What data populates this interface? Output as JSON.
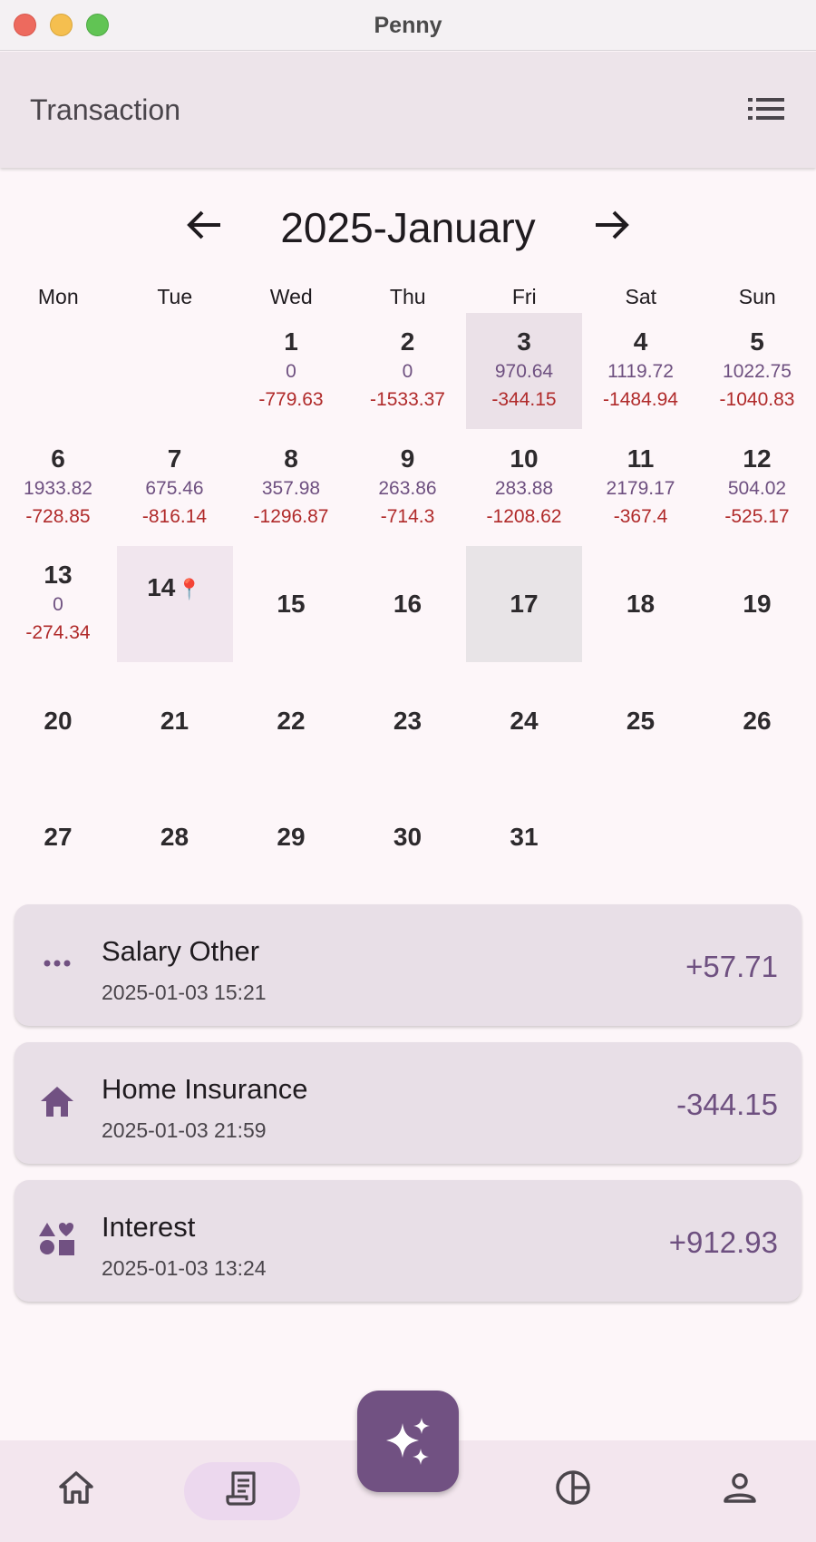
{
  "window": {
    "title": "Penny"
  },
  "appbar": {
    "title": "Transaction",
    "list_icon": "list-icon"
  },
  "calendar": {
    "month_label": "2025-January",
    "prev_icon": "arrow-left-icon",
    "next_icon": "arrow-right-icon",
    "weekdays": [
      "Mon",
      "Tue",
      "Wed",
      "Thu",
      "Fri",
      "Sat",
      "Sun"
    ],
    "days": [
      {
        "day": "1",
        "income": "0",
        "expense": "-779.63"
      },
      {
        "day": "2",
        "income": "0",
        "expense": "-1533.37"
      },
      {
        "day": "3",
        "income": "970.64",
        "expense": "-344.15"
      },
      {
        "day": "4",
        "income": "1119.72",
        "expense": "-1484.94"
      },
      {
        "day": "5",
        "income": "1022.75",
        "expense": "-1040.83"
      },
      {
        "day": "6",
        "income": "1933.82",
        "expense": "-728.85"
      },
      {
        "day": "7",
        "income": "675.46",
        "expense": "-816.14"
      },
      {
        "day": "8",
        "income": "357.98",
        "expense": "-1296.87"
      },
      {
        "day": "9",
        "income": "263.86",
        "expense": "-714.3"
      },
      {
        "day": "10",
        "income": "283.88",
        "expense": "-1208.62"
      },
      {
        "day": "11",
        "income": "2179.17",
        "expense": "-367.4"
      },
      {
        "day": "12",
        "income": "504.02",
        "expense": "-525.17"
      },
      {
        "day": "13",
        "income": "0",
        "expense": "-274.34"
      },
      {
        "day": "14"
      },
      {
        "day": "15"
      },
      {
        "day": "16"
      },
      {
        "day": "17"
      },
      {
        "day": "18"
      },
      {
        "day": "19"
      },
      {
        "day": "20"
      },
      {
        "day": "21"
      },
      {
        "day": "22"
      },
      {
        "day": "23"
      },
      {
        "day": "24"
      },
      {
        "day": "25"
      },
      {
        "day": "26"
      },
      {
        "day": "27"
      },
      {
        "day": "28"
      },
      {
        "day": "29"
      },
      {
        "day": "30"
      },
      {
        "day": "31"
      }
    ],
    "today_marker": "pin-icon"
  },
  "transactions": [
    {
      "title": "Salary Other",
      "time": "2025-01-03 15:21",
      "amount": "+57.71",
      "icon": "more-horizontal-icon"
    },
    {
      "title": "Home Insurance",
      "time": "2025-01-03 21:59",
      "amount": "-344.15",
      "icon": "home-icon"
    },
    {
      "title": "Interest",
      "time": "2025-01-03 13:24",
      "amount": "+912.93",
      "icon": "shapes-icon"
    }
  ],
  "fab": {
    "icon": "sparkle-icon"
  },
  "bottom_nav": [
    "home-icon",
    "receipt-icon",
    "pie-chart-icon",
    "person-icon"
  ],
  "colors": {
    "accent": "#715182",
    "income": "#6e5080",
    "expense": "#b02a2a"
  }
}
